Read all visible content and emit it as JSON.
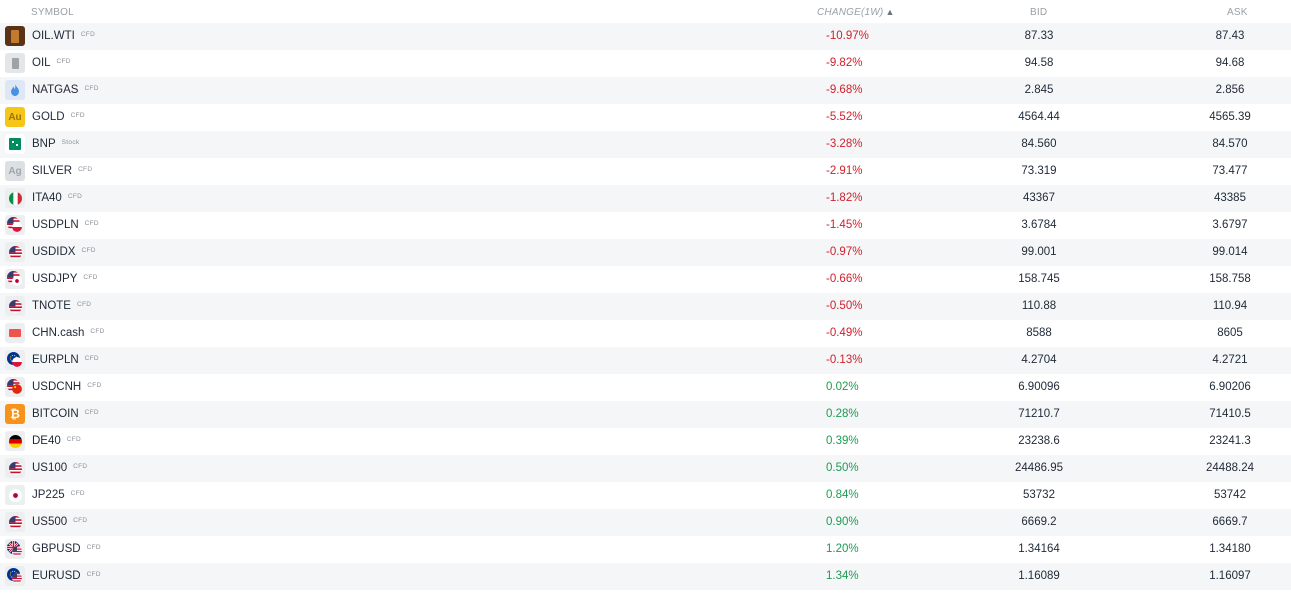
{
  "header": {
    "symbol": "SYMBOL",
    "change": "CHANGE(1W)",
    "sort_icon": "▲",
    "bid": "BID",
    "ask": "ASK"
  },
  "rows": [
    {
      "symbol": "OIL.WTI",
      "type": "CFD",
      "change": "-10.97%",
      "dir": "neg",
      "bid": "87.33",
      "ask": "87.43",
      "icon": "oil-barrel-icon"
    },
    {
      "symbol": "OIL",
      "type": "CFD",
      "change": "-9.82%",
      "dir": "neg",
      "bid": "94.58",
      "ask": "94.68",
      "icon": "oil-barrel-icon"
    },
    {
      "symbol": "NATGAS",
      "type": "CFD",
      "change": "-9.68%",
      "dir": "neg",
      "bid": "2.845",
      "ask": "2.856",
      "icon": "flame-icon"
    },
    {
      "symbol": "GOLD",
      "type": "CFD",
      "change": "-5.52%",
      "dir": "neg",
      "bid": "4564.44",
      "ask": "4565.39",
      "icon": "gold-icon",
      "icon_text": "Au"
    },
    {
      "symbol": "BNP",
      "type": "Stock",
      "change": "-3.28%",
      "dir": "neg",
      "bid": "84.560",
      "ask": "84.570",
      "icon": "bnp-logo-icon"
    },
    {
      "symbol": "SILVER",
      "type": "CFD",
      "change": "-2.91%",
      "dir": "neg",
      "bid": "73.319",
      "ask": "73.477",
      "icon": "silver-icon",
      "icon_text": "Ag"
    },
    {
      "symbol": "ITA40",
      "type": "CFD",
      "change": "-1.82%",
      "dir": "neg",
      "bid": "43367",
      "ask": "43385",
      "icon": "italy-flag-icon"
    },
    {
      "symbol": "USDPLN",
      "type": "CFD",
      "change": "-1.45%",
      "dir": "neg",
      "bid": "3.6784",
      "ask": "3.6797",
      "icon": "usd-pln-flags-icon"
    },
    {
      "symbol": "USDIDX",
      "type": "CFD",
      "change": "-0.97%",
      "dir": "neg",
      "bid": "99.001",
      "ask": "99.014",
      "icon": "us-flag-icon"
    },
    {
      "symbol": "USDJPY",
      "type": "CFD",
      "change": "-0.66%",
      "dir": "neg",
      "bid": "158.745",
      "ask": "158.758",
      "icon": "usd-jpy-flags-icon"
    },
    {
      "symbol": "TNOTE",
      "type": "CFD",
      "change": "-0.50%",
      "dir": "neg",
      "bid": "110.88",
      "ask": "110.94",
      "icon": "us-flag-icon"
    },
    {
      "symbol": "CHN.cash",
      "type": "CFD",
      "change": "-0.49%",
      "dir": "neg",
      "bid": "8588",
      "ask": "8605",
      "icon": "china-flag-icon"
    },
    {
      "symbol": "EURPLN",
      "type": "CFD",
      "change": "-0.13%",
      "dir": "neg",
      "bid": "4.2704",
      "ask": "4.2721",
      "icon": "eur-pln-flags-icon"
    },
    {
      "symbol": "USDCNH",
      "type": "CFD",
      "change": "0.02%",
      "dir": "pos",
      "bid": "6.90096",
      "ask": "6.90206",
      "icon": "usd-cnh-flags-icon"
    },
    {
      "symbol": "BITCOIN",
      "type": "CFD",
      "change": "0.28%",
      "dir": "pos",
      "bid": "71210.7",
      "ask": "71410.5",
      "icon": "bitcoin-icon",
      "icon_text": "₿"
    },
    {
      "symbol": "DE40",
      "type": "CFD",
      "change": "0.39%",
      "dir": "pos",
      "bid": "23238.6",
      "ask": "23241.3",
      "icon": "germany-flag-icon"
    },
    {
      "symbol": "US100",
      "type": "CFD",
      "change": "0.50%",
      "dir": "pos",
      "bid": "24486.95",
      "ask": "24488.24",
      "icon": "us-flag-icon"
    },
    {
      "symbol": "JP225",
      "type": "CFD",
      "change": "0.84%",
      "dir": "pos",
      "bid": "53732",
      "ask": "53742",
      "icon": "japan-flag-icon"
    },
    {
      "symbol": "US500",
      "type": "CFD",
      "change": "0.90%",
      "dir": "pos",
      "bid": "6669.2",
      "ask": "6669.7",
      "icon": "us-flag-icon"
    },
    {
      "symbol": "GBPUSD",
      "type": "CFD",
      "change": "1.20%",
      "dir": "pos",
      "bid": "1.34164",
      "ask": "1.34180",
      "icon": "gbp-usd-flags-icon"
    },
    {
      "symbol": "EURUSD",
      "type": "CFD",
      "change": "1.34%",
      "dir": "pos",
      "bid": "1.16089",
      "ask": "1.16097",
      "icon": "eur-usd-flags-icon"
    }
  ],
  "colors": {
    "negative": "#d0202c",
    "positive": "#1e9b53",
    "header_text": "#9aa0a6",
    "row_alt": "#f5f6f7"
  }
}
